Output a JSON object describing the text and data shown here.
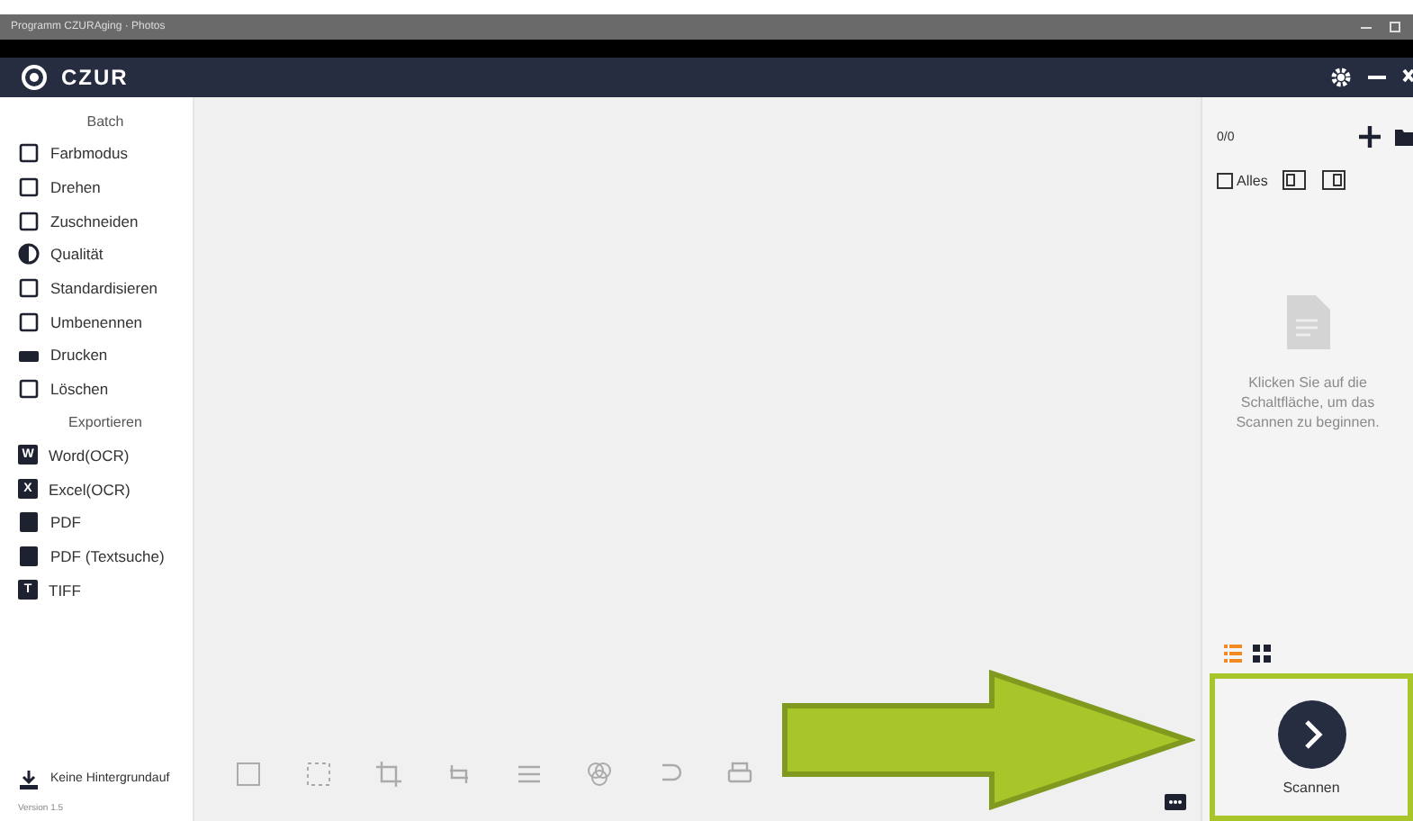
{
  "window": {
    "title": "Programm CZURAging · Photos"
  },
  "header": {
    "logo": "CZUR"
  },
  "sidebar": {
    "items": [
      {
        "kind": "section",
        "label": "Batch"
      },
      {
        "kind": "item",
        "label": "Farbmodus"
      },
      {
        "kind": "item",
        "label": "Drehen"
      },
      {
        "kind": "item",
        "label": "Zuschneiden"
      },
      {
        "kind": "item",
        "label": "Qualität"
      },
      {
        "kind": "item",
        "label": "Standardisieren"
      },
      {
        "kind": "item",
        "label": "Umbenennen"
      },
      {
        "kind": "item",
        "label": "Drucken"
      },
      {
        "kind": "item",
        "label": "Löschen"
      },
      {
        "kind": "section",
        "label": "Exportieren"
      },
      {
        "kind": "export",
        "label": "Word(OCR)",
        "badge": "W"
      },
      {
        "kind": "export",
        "label": "Excel(OCR)",
        "badge": "X"
      },
      {
        "kind": "item",
        "label": "PDF"
      },
      {
        "kind": "item",
        "label": "PDF (Textsuche)"
      },
      {
        "kind": "export",
        "label": "TIFF",
        "badge": "T"
      }
    ],
    "background_option": "Keine Hintergrundauf",
    "version": "Version 1.5"
  },
  "panel": {
    "count": "0/0",
    "select_all": {
      "label": "Alles",
      "checked": false
    },
    "empty_message": "Klicken Sie auf die Schaltfläche, um das Scannen zu beginnen.",
    "view_modes": [
      {
        "selected": true
      },
      {
        "selected": false
      }
    ],
    "scan_button": "Scannen"
  }
}
